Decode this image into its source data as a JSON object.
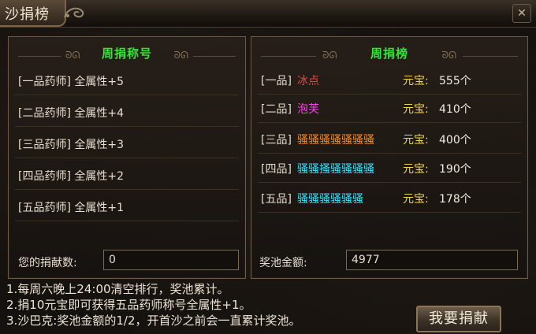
{
  "window": {
    "title": "沙捐榜"
  },
  "left_panel": {
    "title": "周捐称号",
    "items": [
      {
        "label": "[一品药师] 全属性+5"
      },
      {
        "label": "[二品药师] 全属性+4"
      },
      {
        "label": "[三品药师] 全属性+3"
      },
      {
        "label": "[四品药师] 全属性+2"
      },
      {
        "label": "[五品药师] 全属性+1"
      }
    ],
    "donation_label": "您的捐献数:",
    "donation_value": "0"
  },
  "right_panel": {
    "title": "周捐榜",
    "rows": [
      {
        "rank": "[一品]",
        "name": "冰点",
        "name_color": "#ff3b3b",
        "currency": "元宝:",
        "amount": "555个"
      },
      {
        "rank": "[二品]",
        "name": "泡芙",
        "name_color": "#ff3cf0",
        "currency": "元宝:",
        "amount": "410个"
      },
      {
        "rank": "[三品]",
        "name": "骚骚骚骚骚骚骚",
        "name_color": "#ff8a1e",
        "currency": "元宝:",
        "amount": "400个"
      },
      {
        "rank": "[四品]",
        "name": "骚骚搔骚骚骚骚",
        "name_color": "#2fe6ff",
        "currency": "元宝:",
        "amount": "190个"
      },
      {
        "rank": "[五品]",
        "name": "骚骚骚骚骚骚",
        "name_color": "#2fe6ff",
        "currency": "元宝:",
        "amount": "178个"
      }
    ],
    "pool_label": "奖池金额:",
    "pool_value": "4977"
  },
  "rules": [
    "1.每周六晚上24:00清空排行，奖池累计。",
    "2.捐10元宝即可获得五品药师称号全属性+1。",
    "3.沙巴克:奖池金额的1/2，开首沙之前会一直累计奖池。"
  ],
  "donate_button": {
    "label": "我要捐献"
  },
  "icons": {
    "close": "close-icon",
    "title_ornament": "dragon-ornament-icon"
  },
  "colors": {
    "title_green": "#35e23a",
    "yuanbao": "#f2d64a"
  }
}
